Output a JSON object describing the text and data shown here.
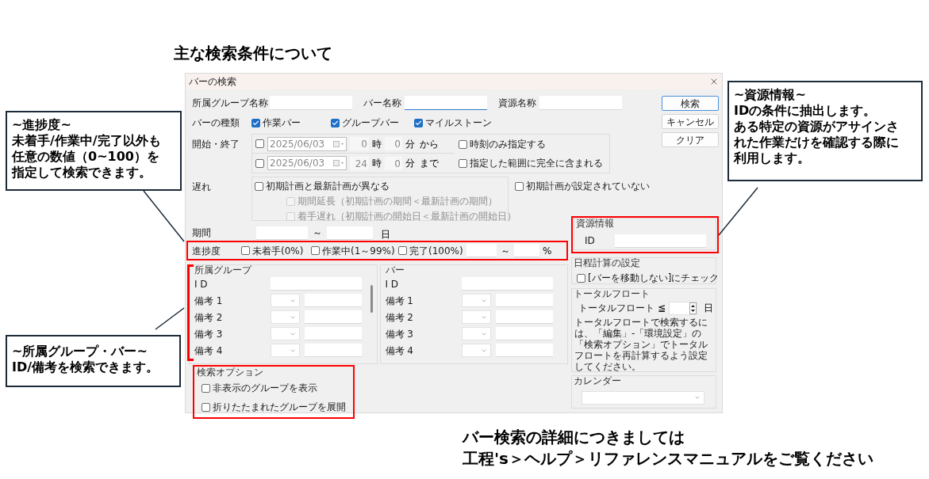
{
  "heading": "主な検索条件について",
  "dialog": {
    "title": "バーの検索",
    "top_fields": [
      {
        "label": "所属グループ名称",
        "focused": false
      },
      {
        "label": "バー名称",
        "focused": true
      },
      {
        "label": "資源名称",
        "focused": false
      }
    ],
    "buttons": [
      {
        "label": "検索",
        "default": true
      },
      {
        "label": "キャンセル",
        "default": false
      },
      {
        "label": "クリア",
        "default": false
      }
    ],
    "bar_types": {
      "label": "バーの種類",
      "options": [
        {
          "label": "作業バー",
          "checked": true
        },
        {
          "label": "グループバー",
          "checked": true
        },
        {
          "label": "マイルストーン",
          "checked": true
        }
      ]
    },
    "start_end": {
      "label": "開始・終了",
      "rows": [
        {
          "checked": false,
          "disabled": true,
          "date": "2025/06/03",
          "hour": "0",
          "hour_unit": "時",
          "minute": "0",
          "minute_unit": "分",
          "suffix": "から"
        },
        {
          "checked": false,
          "disabled": true,
          "date": "2025/06/03",
          "hour": "24",
          "hour_unit": "時",
          "minute": "0",
          "minute_unit": "分",
          "suffix": "まで"
        }
      ],
      "options": [
        {
          "label": "時刻のみ指定する",
          "checked": false
        },
        {
          "label": "指定した範囲に完全に含まれる",
          "checked": false
        }
      ]
    },
    "delay": {
      "label": "遅れ",
      "main": {
        "label": "初期計画と最新計画が異なる",
        "checked": false
      },
      "sub": [
        {
          "label": "期間延長（初期計画の期間＜最新計画の期間）",
          "checked": false,
          "disabled": true
        },
        {
          "label": "着手遅れ（初期計画の開始日＜最新計画の開始日）",
          "checked": false,
          "disabled": true
        }
      ],
      "other": {
        "label": "初期計画が設定されていない",
        "checked": false
      }
    },
    "duration": {
      "label": "期間",
      "separator": "～",
      "unit": "日"
    },
    "progress": {
      "label": "進捗度",
      "options": [
        {
          "label": "未着手(0%)",
          "checked": false
        },
        {
          "label": "作業中(1～99%)",
          "checked": false
        },
        {
          "label": "完了(100%)",
          "checked": false
        }
      ],
      "separator": "～",
      "unit": "%"
    },
    "panels": [
      {
        "title": "所属グループ",
        "rows": [
          {
            "label": "I D",
            "kind": "text"
          },
          {
            "label": "備考 1",
            "kind": "remark"
          },
          {
            "label": "備考 2",
            "kind": "remark"
          },
          {
            "label": "備考 3",
            "kind": "remark"
          },
          {
            "label": "備考 4",
            "kind": "remark"
          }
        ]
      },
      {
        "title": "バー",
        "rows": [
          {
            "label": "I D",
            "kind": "text"
          },
          {
            "label": "備考 1",
            "kind": "remark"
          },
          {
            "label": "備考 2",
            "kind": "remark"
          },
          {
            "label": "備考 3",
            "kind": "remark"
          },
          {
            "label": "備考 4",
            "kind": "remark"
          }
        ]
      }
    ],
    "search_options": {
      "title": "検索オプション",
      "options": [
        {
          "label": "非表示のグループを表示",
          "checked": false
        },
        {
          "label": "折りたたまれたグループを展開",
          "checked": false
        }
      ]
    },
    "resource": {
      "title": "資源情報",
      "label": "ID"
    },
    "schedule": {
      "title": "日程計算の設定",
      "option": {
        "label": "[バーを移動しない]にチェック",
        "checked": false
      }
    },
    "total_float": {
      "title": "トータルフロート",
      "label": "トータルフロート",
      "operator": "≦",
      "unit": "日",
      "note": "トータルフロートで検索するには、「編集」-「環境設定」の「検索オプション」でトータルフロートを再計算するよう設定してください。"
    },
    "calendar": {
      "title": "カレンダー"
    }
  },
  "callouts": [
    {
      "lines": [
        "~進捗度~",
        "未着手/作業中/完了以外も",
        "任意の数値（0~100）を",
        "指定して検索できます。"
      ]
    },
    {
      "lines": [
        "~所属グループ・バー~",
        "ID/備考を検索できます。"
      ]
    },
    {
      "lines": [
        "~資源情報~",
        "IDの条件に抽出します。",
        "ある特定の資源がアサインさ",
        "れた作業だけを確認する際に",
        "利用します。"
      ]
    }
  ],
  "footer": [
    "バー検索の詳細につきましては",
    "工程's＞ヘルプ＞リファレンスマニュアルをご覧ください"
  ]
}
